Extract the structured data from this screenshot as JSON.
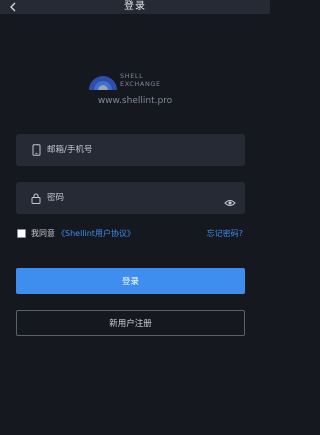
{
  "header": {
    "title": "登录",
    "back_icon": "chevron-left-icon"
  },
  "logo": {
    "line1": "SHELL",
    "line2": "EXCHANGE",
    "url": "www.shellint.pro",
    "colors": [
      "#2f4ea8",
      "#3d6fd8",
      "#9aa5b6"
    ]
  },
  "form": {
    "account_placeholder": "邮箱/手机号",
    "account_icon": "phone-icon",
    "password_placeholder": "密码",
    "password_icon": "lock-icon",
    "visibility_icon": "eye-icon"
  },
  "agreement": {
    "label": "我同意",
    "link": "《Shellint用户协议》",
    "forgot": "忘记密码?"
  },
  "buttons": {
    "login": "登录",
    "register": "新用户注册"
  },
  "colors": {
    "background": "#15181f",
    "panel": "#262a34",
    "accent": "#3e8eef"
  }
}
